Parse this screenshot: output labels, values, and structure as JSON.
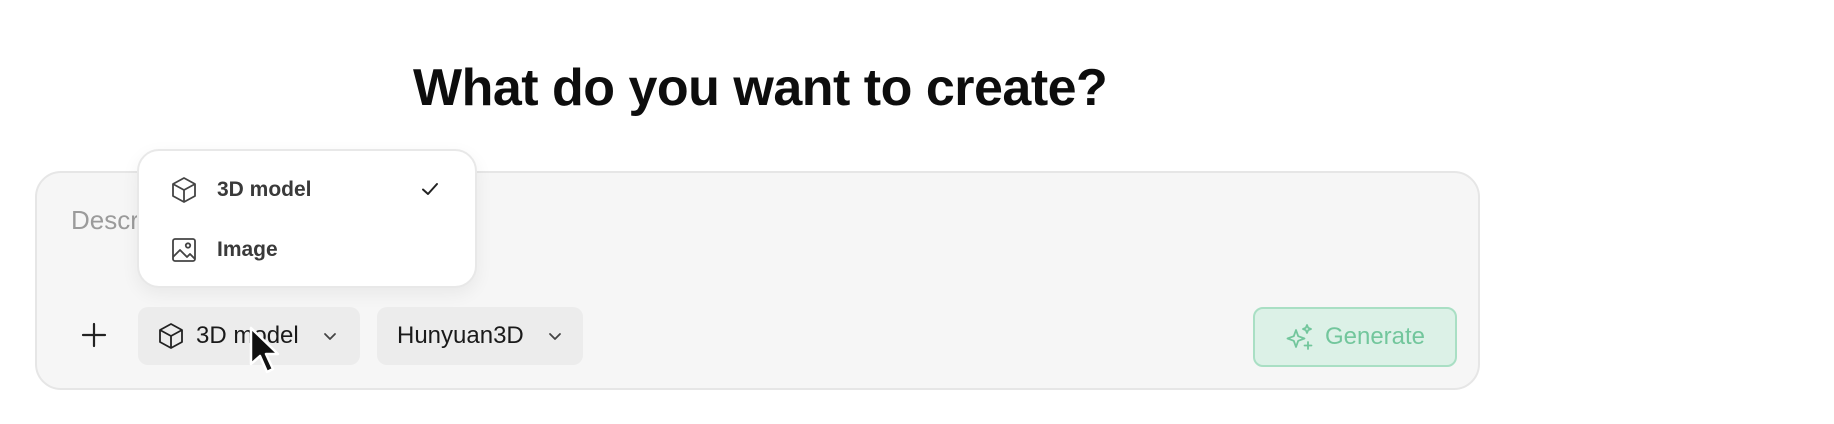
{
  "heading": "What do you want to create?",
  "prompt": {
    "placeholder": "Describe what you want to create"
  },
  "toolbar": {
    "add_icon": "plus-icon",
    "mode_selector": {
      "label": "3D model",
      "icon": "cube-icon",
      "chevron": "chevron-down-icon"
    },
    "model_selector": {
      "label": "Hunyuan3D",
      "chevron": "chevron-down-icon"
    },
    "generate": {
      "label": "Generate",
      "icon": "sparkle-icon",
      "state": "disabled"
    }
  },
  "mode_menu": {
    "items": [
      {
        "label": "3D model",
        "icon": "cube-icon",
        "selected": true
      },
      {
        "label": "Image",
        "icon": "image-icon",
        "selected": false
      }
    ]
  },
  "colors": {
    "accent_green": "#72c69c",
    "generate_bg": "#dcf1e7",
    "panel_bg": "#f6f6f6"
  }
}
